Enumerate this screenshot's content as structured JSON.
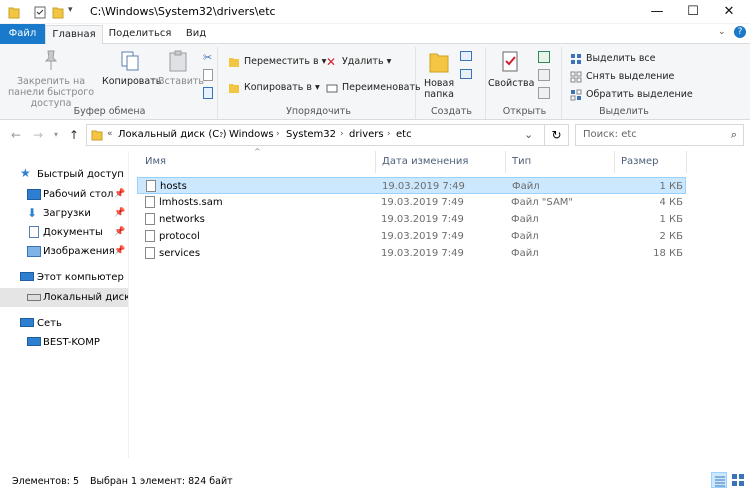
{
  "title_bar": {
    "path_title": "C:\\Windows\\System32\\drivers\\etc",
    "minimize": "—",
    "maximize": "☐",
    "close": "✕"
  },
  "ribbon_tabs": [
    "Файл",
    "Главная",
    "Поделиться",
    "Вид"
  ],
  "ribbon": {
    "clipboard": {
      "pin": "Закрепить на панели быстрого доступа",
      "copy": "Копировать",
      "paste": "Вставить",
      "label": "Буфер обмена"
    },
    "organize": {
      "move_to": "Переместить в",
      "copy_to": "Копировать в",
      "delete": "Удалить",
      "rename": "Переименовать",
      "label": "Упорядочить"
    },
    "new": {
      "new_folder": "Новая папка",
      "label": "Создать"
    },
    "open": {
      "properties": "Свойства",
      "label": "Открыть"
    },
    "select": {
      "select_all": "Выделить все",
      "select_none": "Снять выделение",
      "invert": "Обратить выделение",
      "label": "Выделить"
    }
  },
  "address": {
    "crumbs": [
      "Локальный диск (C:)",
      "Windows",
      "System32",
      "drivers",
      "etc"
    ],
    "search_placeholder": "Поиск: etc"
  },
  "nav": {
    "quick_access": "Быстрый доступ",
    "items": [
      "Рабочий стол",
      "Загрузки",
      "Документы",
      "Изображения"
    ],
    "this_pc": "Этот компьютер",
    "local_disk": "Локальный диск (C:)",
    "network": "Сеть",
    "computer": "BEST-KOMP"
  },
  "columns": [
    "Имя",
    "Дата изменения",
    "Тип",
    "Размер"
  ],
  "files": [
    {
      "name": "hosts",
      "date": "19.03.2019 7:49",
      "type": "Файл",
      "size": "1 КБ",
      "selected": true
    },
    {
      "name": "lmhosts.sam",
      "date": "19.03.2019 7:49",
      "type": "Файл \"SAM\"",
      "size": "4 КБ",
      "selected": false
    },
    {
      "name": "networks",
      "date": "19.03.2019 7:49",
      "type": "Файл",
      "size": "1 КБ",
      "selected": false
    },
    {
      "name": "protocol",
      "date": "19.03.2019 7:49",
      "type": "Файл",
      "size": "2 КБ",
      "selected": false
    },
    {
      "name": "services",
      "date": "19.03.2019 7:49",
      "type": "Файл",
      "size": "18 КБ",
      "selected": false
    }
  ],
  "status": {
    "count": "Элементов: 5",
    "selection": "Выбран 1 элемент: 824 байт"
  },
  "colors": {
    "file_tab": "#1979ca",
    "selection_bg": "#cce8ff",
    "folder_yellow": "#f4c542"
  }
}
